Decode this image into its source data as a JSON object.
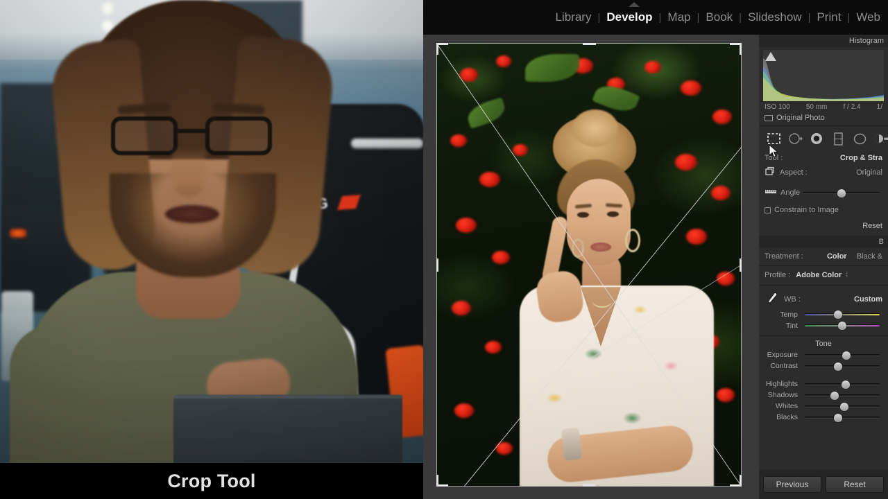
{
  "caption": {
    "text": "Crop Tool"
  },
  "lightroom": {
    "module_nav": [
      {
        "label": "Library",
        "active": false
      },
      {
        "label": "Develop",
        "active": true
      },
      {
        "label": "Map",
        "active": false
      },
      {
        "label": "Book",
        "active": false
      },
      {
        "label": "Slideshow",
        "active": false
      },
      {
        "label": "Print",
        "active": false
      },
      {
        "label": "Web",
        "active": false
      }
    ],
    "separator": "|",
    "histogram": {
      "title": "Histogram",
      "exif": {
        "iso": "ISO 100",
        "focal": "50 mm",
        "aperture": "f / 2.4",
        "shutter": "1/"
      },
      "original_photo_label": "Original Photo"
    },
    "tools": [
      {
        "name": "crop-overlay-tool",
        "selected": true
      },
      {
        "name": "spot-removal-tool",
        "selected": false
      },
      {
        "name": "red-eye-correction-tool",
        "selected": false
      },
      {
        "name": "graduated-filter-tool",
        "selected": false
      },
      {
        "name": "radial-filter-tool",
        "selected": false
      },
      {
        "name": "adjustment-brush-tool",
        "selected": false
      }
    ],
    "crop_panel": {
      "tool_label": "Tool :",
      "tool_value": "Crop & Stra",
      "aspect_label": "Aspect :",
      "aspect_value": "Original",
      "angle_label": "Angle",
      "angle_knob_pct": 50,
      "constrain_label": "Constrain to Image",
      "reset_label": "Reset"
    },
    "basic_panel": {
      "title": "B",
      "treatment_label": "Treatment :",
      "treatment_color": "Color",
      "treatment_bw": "Black &",
      "profile_label": "Profile :",
      "profile_value": "Adobe Color",
      "wb_label": "WB :",
      "wb_value": "Custom",
      "wb_sliders": [
        {
          "name": "Temp",
          "knob_pct": 44
        },
        {
          "name": "Tint",
          "knob_pct": 50
        }
      ],
      "tone_title": "Tone",
      "tone_sliders": [
        {
          "name": "Exposure",
          "knob_pct": 56
        },
        {
          "name": "Contrast",
          "knob_pct": 44
        },
        {
          "name": "Highlights",
          "knob_pct": 55
        },
        {
          "name": "Shadows",
          "knob_pct": 40
        },
        {
          "name": "Whites",
          "knob_pct": 53
        },
        {
          "name": "Blacks",
          "knob_pct": 44
        }
      ]
    },
    "footer": {
      "previous_label": "Previous",
      "reset_label": "Reset"
    }
  },
  "colors": {
    "panel_bg": "#2c2c2c",
    "canvas_bg": "#3a3a3a",
    "topbar_bg": "#0b0b0b",
    "active_text": "#fafafa",
    "inactive_text": "#8f8f8f",
    "accent_orange": "#f0571d"
  }
}
